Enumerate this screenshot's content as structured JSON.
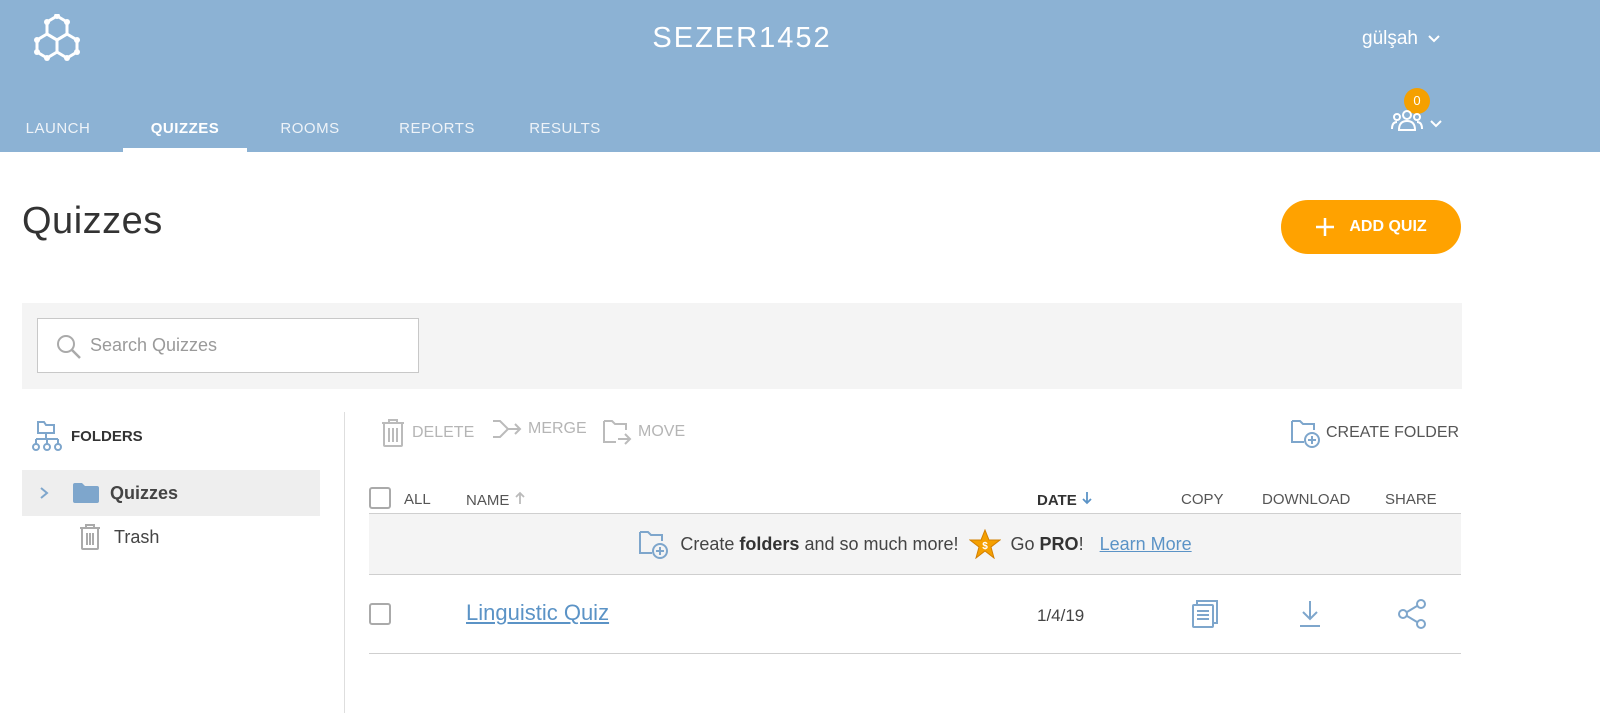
{
  "header": {
    "room_name": "SEZER1452",
    "user_name": "gülşah",
    "student_count": "0",
    "nav_tabs": [
      {
        "label": "LAUNCH",
        "active": false
      },
      {
        "label": "QUIZZES",
        "active": true
      },
      {
        "label": "ROOMS",
        "active": false
      },
      {
        "label": "REPORTS",
        "active": false
      },
      {
        "label": "RESULTS",
        "active": false
      }
    ]
  },
  "page": {
    "title": "Quizzes",
    "add_quiz_label": "ADD QUIZ"
  },
  "search": {
    "placeholder": "Search Quizzes",
    "value": ""
  },
  "folders": {
    "heading": "FOLDERS",
    "items": [
      {
        "label": "Quizzes",
        "selected": true
      },
      {
        "label": "Trash",
        "selected": false
      }
    ]
  },
  "toolbar": {
    "delete_label": "DELETE",
    "merge_label": "MERGE",
    "move_label": "MOVE",
    "create_folder_label": "CREATE FOLDER"
  },
  "table": {
    "headers": {
      "all": "ALL",
      "name": "NAME",
      "date": "DATE",
      "copy": "COPY",
      "download": "DOWNLOAD",
      "share": "SHARE"
    },
    "promo": {
      "prefix": "Create",
      "bold1": "folders",
      "middle": "and so much more!",
      "go": "Go",
      "pro": "PRO",
      "exclaim": "!",
      "link": "Learn More"
    },
    "rows": [
      {
        "name": "Linguistic Quiz",
        "date": "1/4/19"
      }
    ]
  },
  "colors": {
    "header_bg": "#8cb2d4",
    "accent_orange": "#ffa200",
    "link_blue": "#5b93c6",
    "icon_blue": "#7ea6cc"
  }
}
